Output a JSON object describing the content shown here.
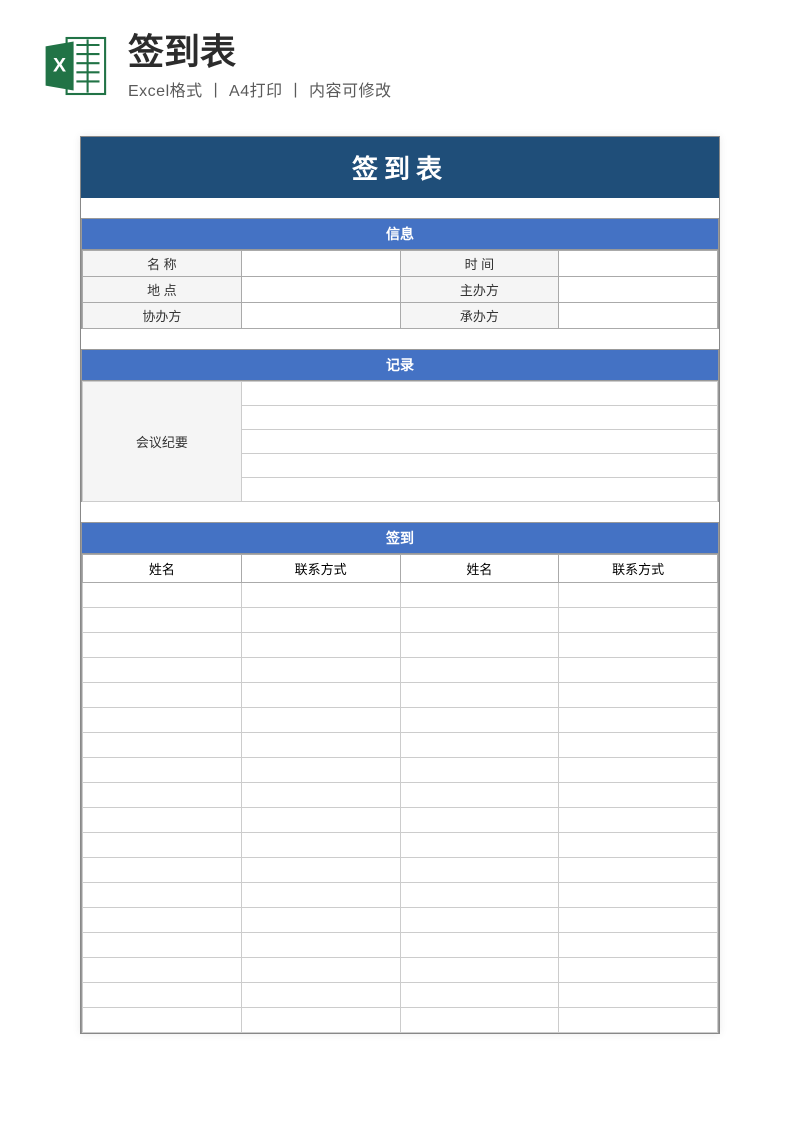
{
  "header": {
    "title": "签到表",
    "subtitle": "Excel格式 丨 A4打印 丨 内容可修改",
    "icon_name": "excel-icon"
  },
  "sheet": {
    "title": "签到表",
    "info": {
      "section_label": "信息",
      "rows": [
        {
          "l1": "名 称",
          "v1": "",
          "l2": "时 间",
          "v2": ""
        },
        {
          "l1": "地 点",
          "v1": "",
          "l2": "主办方",
          "v2": ""
        },
        {
          "l1": "协办方",
          "v1": "",
          "l2": "承办方",
          "v2": ""
        }
      ]
    },
    "record": {
      "section_label": "记录",
      "label": "会议纪要",
      "line_count": 5
    },
    "signin": {
      "section_label": "签到",
      "columns": [
        "姓名",
        "联系方式",
        "姓名",
        "联系方式"
      ],
      "row_count": 18
    }
  }
}
